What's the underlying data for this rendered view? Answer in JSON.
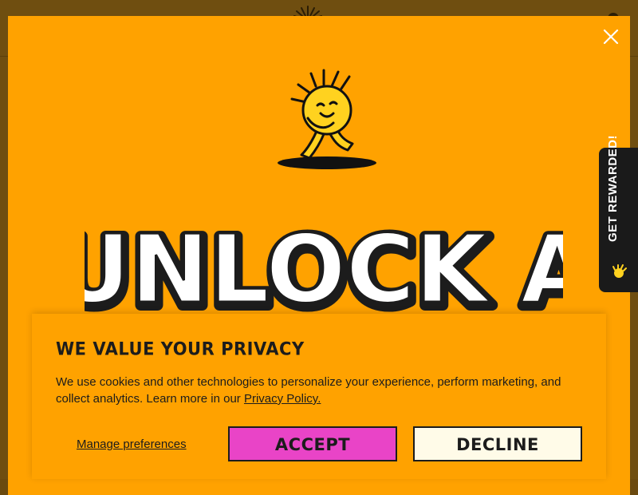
{
  "modal": {
    "headline": "UNLOCK A MYSTERY",
    "close_label": "close"
  },
  "reward_tab": {
    "label": "GET REWARDED!"
  },
  "cookie": {
    "title": "WE VALUE YOUR PRIVACY",
    "body_text": "We use cookies and other technologies to personalize your experience, perform marketing, and collect analytics. Learn more in our ",
    "privacy_link": "Privacy Policy.",
    "manage_label": "Manage preferences",
    "accept_label": "ACCEPT",
    "decline_label": "DECLINE"
  },
  "colors": {
    "modal_bg": "#ffa200",
    "accept_bg": "#e944c7",
    "decline_bg": "#fffbe8",
    "dark": "#1c1c1c"
  }
}
